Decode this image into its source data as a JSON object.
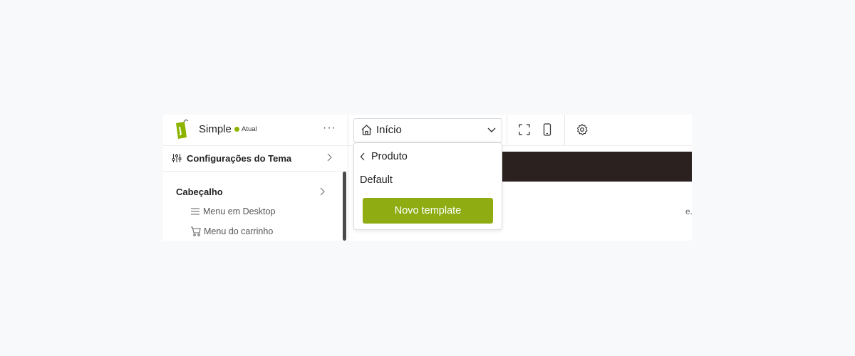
{
  "sidebar": {
    "theme_name": "Simple",
    "badge_label": "Atual",
    "more_label": "···",
    "theme_settings_label": "Configurações do Tema",
    "section_label": "Cabeçalho",
    "items": [
      {
        "label": "Menu em Desktop",
        "icon": "menu-icon"
      },
      {
        "label": "Menu do carrinho",
        "icon": "cart-icon"
      }
    ]
  },
  "toolbar": {
    "page_select_value": "Início",
    "icons": [
      "fullscreen-icon",
      "mobile-icon",
      "settings-icon"
    ]
  },
  "dropdown": {
    "back_label": "Produto",
    "option_label": "Default",
    "button_label": "Novo template"
  },
  "preview": {
    "peek_text": "e..."
  },
  "colors": {
    "accent": "#8fad13",
    "badge_dot": "#8cb400",
    "preview_bar": "#2b2220"
  }
}
